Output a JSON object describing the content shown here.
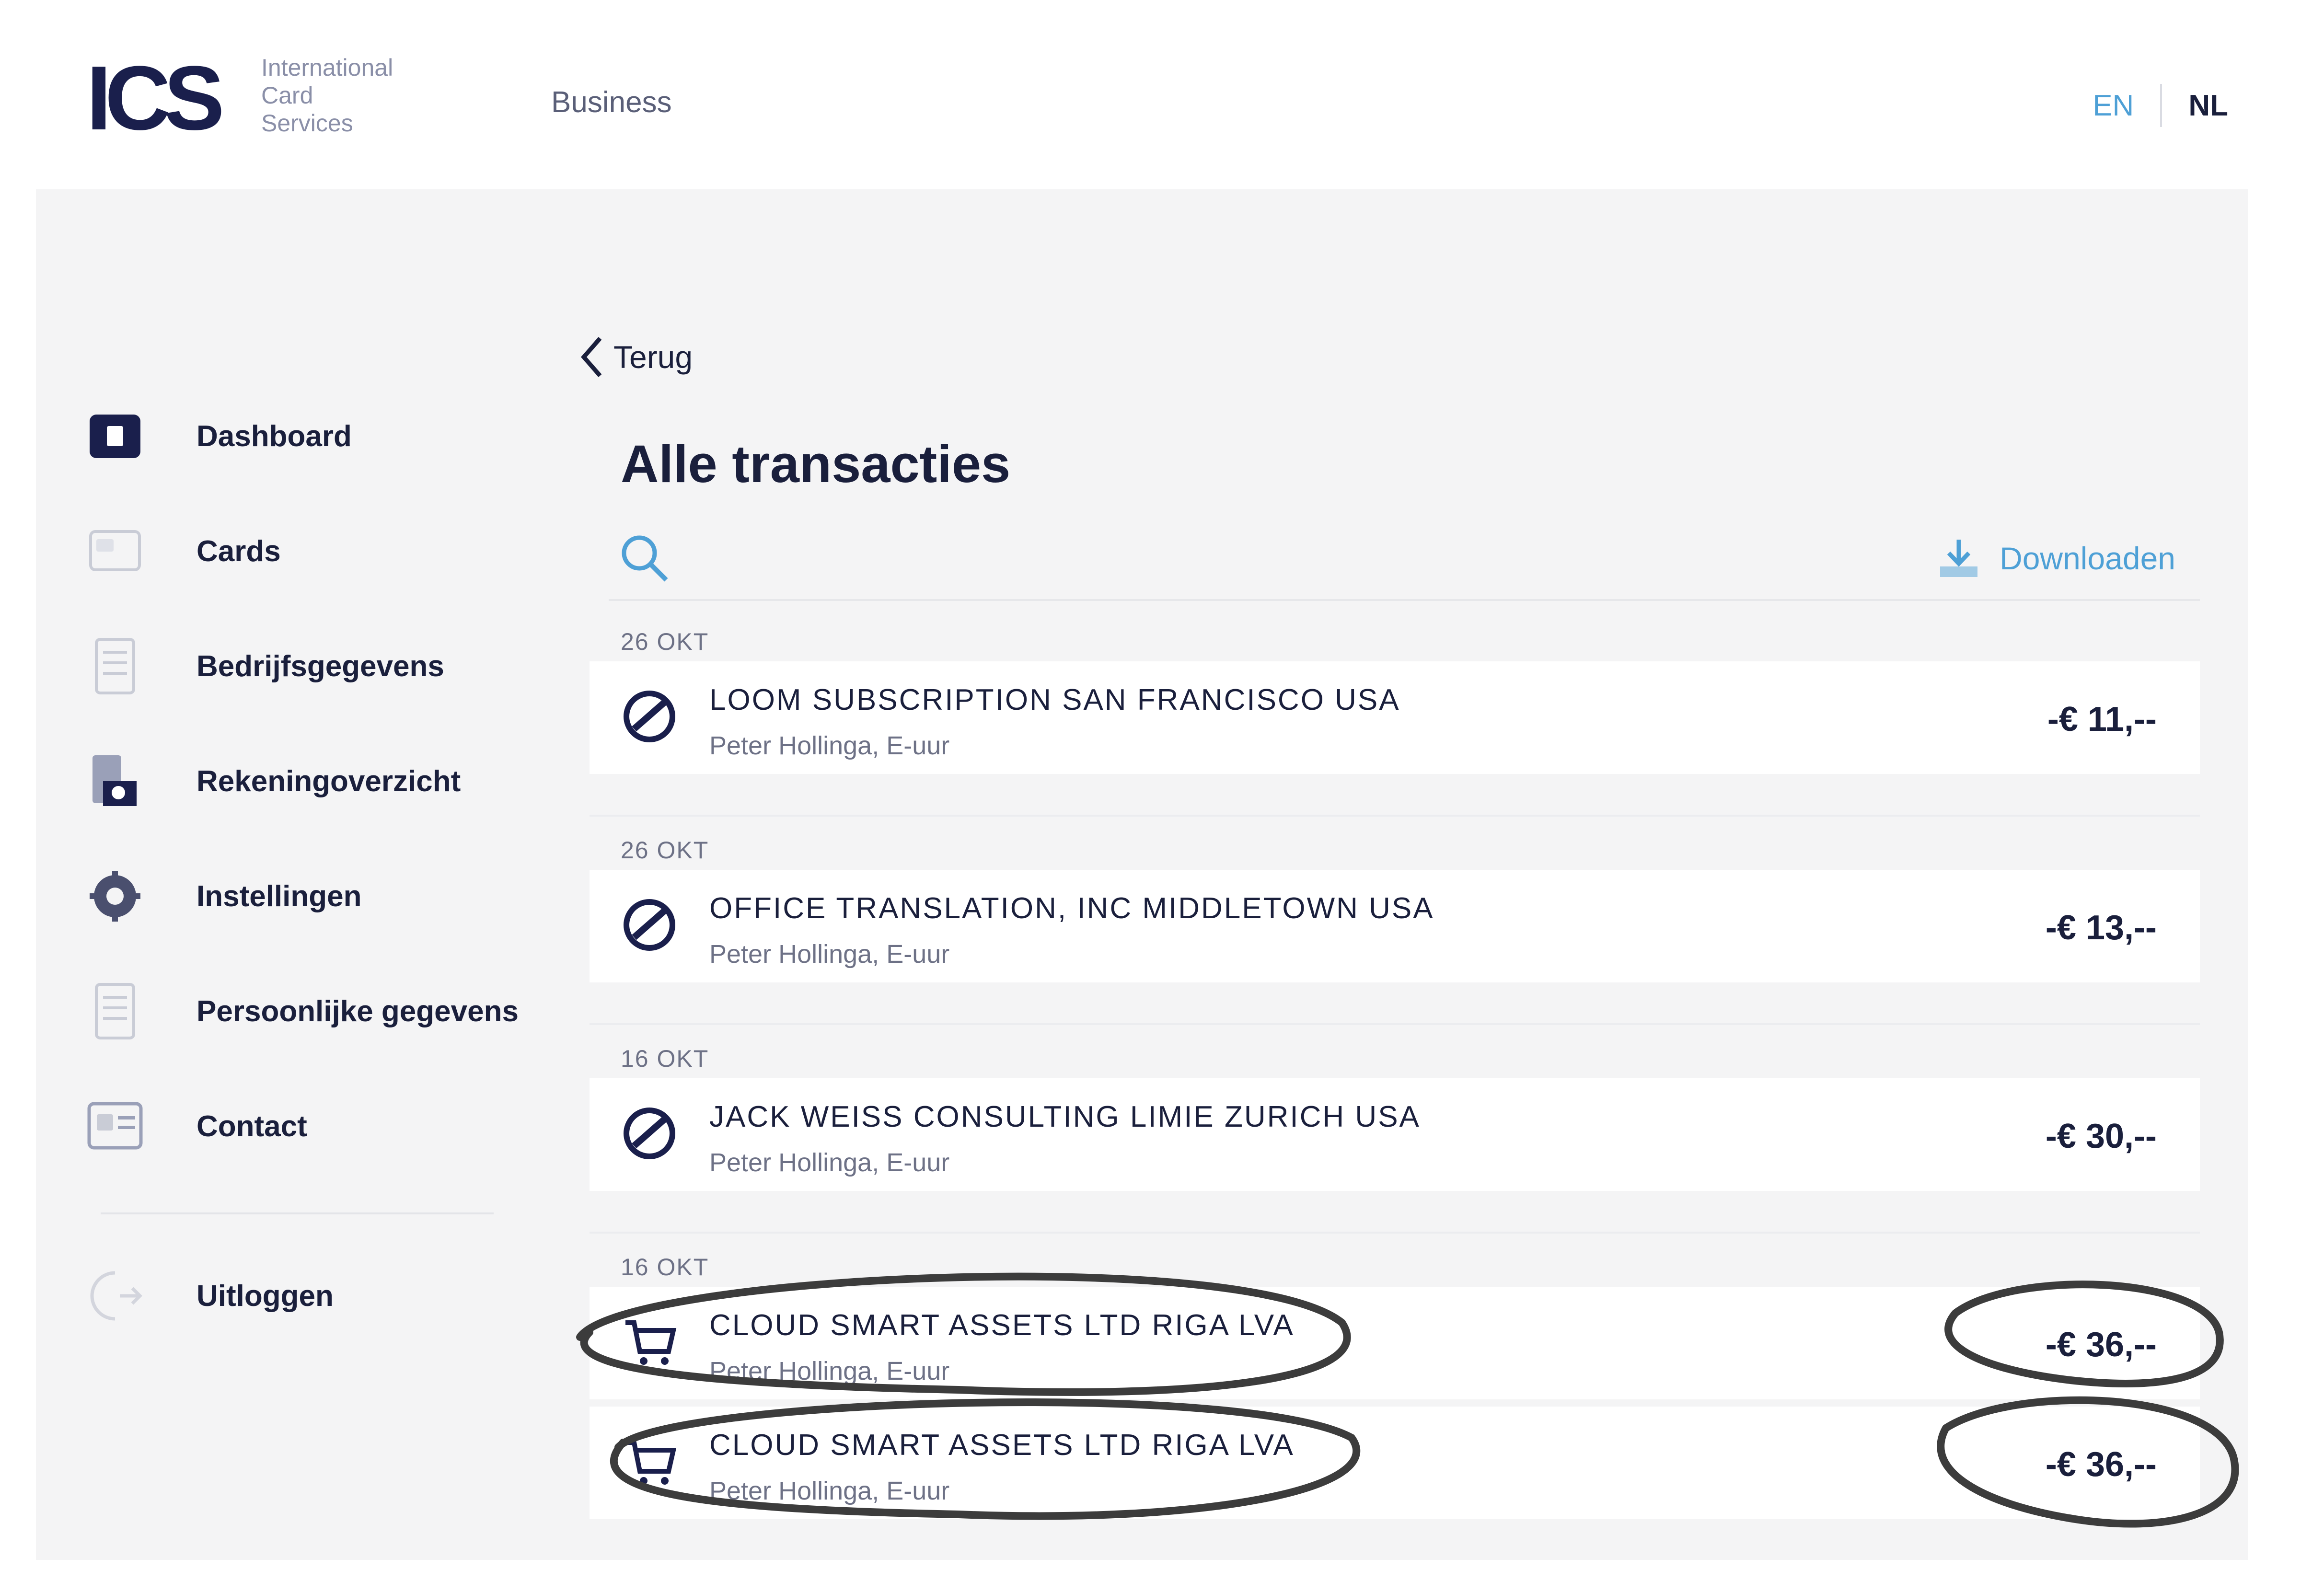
{
  "header": {
    "logo_mark": "ICS",
    "logo_lines": [
      "International",
      "Card",
      "Services"
    ],
    "section": "Business",
    "lang_active": "EN",
    "lang_other": "NL"
  },
  "sidebar": {
    "items": [
      {
        "label": "Dashboard",
        "icon": "dashboard-icon"
      },
      {
        "label": "Cards",
        "icon": "card-icon"
      },
      {
        "label": "Bedrijfsgegevens",
        "icon": "document-icon"
      },
      {
        "label": "Rekeningoverzicht",
        "icon": "statement-icon"
      },
      {
        "label": "Instellingen",
        "icon": "gear-icon"
      },
      {
        "label": "Persoonlijke gegevens",
        "icon": "document-icon"
      },
      {
        "label": "Contact",
        "icon": "contact-icon"
      }
    ],
    "logout_label": "Uitloggen"
  },
  "content": {
    "back_label": "Terug",
    "title": "Alle transacties",
    "download_label": "Downloaden",
    "groups": [
      {
        "date": "26 OKT",
        "transactions": [
          {
            "title": "LOOM SUBSCRIPTION SAN FRANCISCO USA",
            "subtitle": "Peter Hollinga, E-uur",
            "amount": "-€ 11,--"
          }
        ]
      },
      {
        "date": "26 OKT",
        "transactions": [
          {
            "title": "OFFICE TRANSLATION, INC MIDDLETOWN USA",
            "subtitle": "Peter Hollinga, E-uur",
            "amount": "-€ 13,--"
          }
        ]
      },
      {
        "date": "16 OKT",
        "transactions": [
          {
            "title": "JACK WEISS CONSULTING LIMIE ZURICH USA",
            "subtitle": "Peter Hollinga, E-uur",
            "amount": "-€ 30,--"
          }
        ]
      },
      {
        "date": "16 OKT",
        "transactions": [
          {
            "title": "CLOUD SMART ASSETS LTD RIGA LVA",
            "subtitle": "Peter Hollinga, E-uur",
            "amount": "-€ 36,--"
          },
          {
            "title": "CLOUD SMART ASSETS LTD RIGA LVA",
            "subtitle": "Peter Hollinga, E-uur",
            "amount": "-€ 36,--"
          }
        ]
      }
    ]
  },
  "colors": {
    "brand": "#1a1f4c",
    "accent": "#4ea0d6",
    "panel": "#f4f4f5",
    "annotation": "#3c3c3c"
  }
}
